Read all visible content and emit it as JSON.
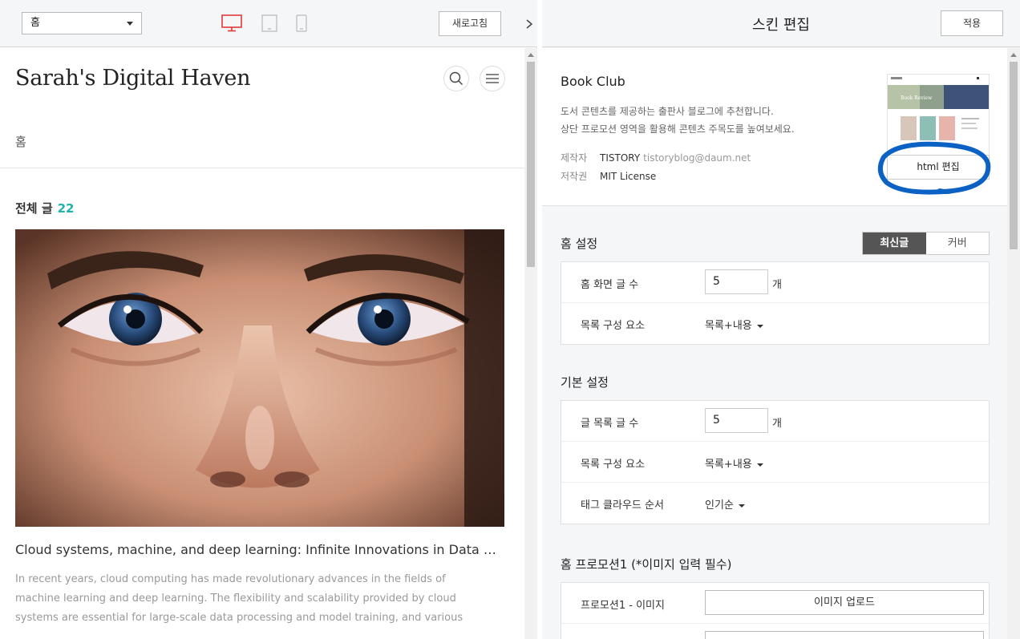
{
  "left": {
    "page_select": "홈",
    "refresh_label": "새로고침",
    "devices": [
      "desktop-icon",
      "tablet-icon",
      "mobile-icon"
    ],
    "blog": {
      "title": "Sarah's Digital Haven",
      "nav_home": "홈",
      "total_label": "전체 글",
      "total_count": "22",
      "post": {
        "title": "Cloud systems, machine, and deep learning: Infinite Innovations in Data Proc…",
        "excerpt": "In recent years, cloud computing has made revolutionary advances in the fields of machine learning and deep learning. The flexibility and scalability provided by cloud systems are essential for large-scale data processing and model training, and various companies and…"
      }
    }
  },
  "right": {
    "title": "스킨 편집",
    "apply_label": "적용",
    "skin": {
      "name": "Book Club",
      "desc_line1": "도서 콘텐츠를 제공하는 출판사 블로그에 추천합니다.",
      "desc_line2": "상단 프로모션 영역을 활용해 콘텐츠 주목도를 높여보세요.",
      "author_label": "제작자",
      "author": "TISTORY",
      "author_email": "tistoryblog@daum.net",
      "license_label": "저작권",
      "license": "MIT License",
      "html_edit_label": "html 편집",
      "thumb_caption": "Book Review"
    },
    "home_settings": {
      "title": "홈 설정",
      "toggle_latest": "최신글",
      "toggle_cover": "커버",
      "posts_label": "홈 화면 글 수",
      "posts_value": "5",
      "unit": "개",
      "list_label": "목록 구성 요소",
      "list_value": "목록+내용"
    },
    "basic_settings": {
      "title": "기본 설정",
      "posts_label": "글 목록 글 수",
      "posts_value": "5",
      "unit": "개",
      "list_label": "목록 구성 요소",
      "list_value": "목록+내용",
      "tag_label": "태그 클라우드 순서",
      "tag_value": "인기순"
    },
    "promo": {
      "title": "홈 프로모션1 (*이미지 입력 필수)",
      "image_label": "프로모션1 - 이미지",
      "upload_label": "이미지 업로드"
    }
  },
  "colors": {
    "accent": "#20b2aa",
    "active_toggle": "#555555",
    "annotation": "#0b62c4",
    "desktop_icon": "#e03a3a"
  }
}
